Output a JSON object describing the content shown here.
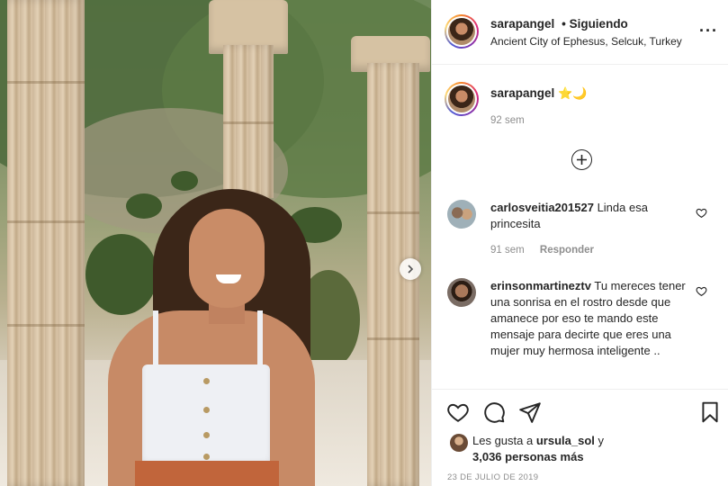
{
  "header": {
    "username": "sarapangel",
    "separator": "•",
    "follow_status": "Siguiendo",
    "location": "Ancient City of Ephesus, Selcuk, Turkey",
    "more_icon": "more-options-icon"
  },
  "caption": {
    "username": "sarapangel",
    "emojis": "⭐🌙",
    "time": "92 sem"
  },
  "comments": [
    {
      "username": "carlosveitia201527",
      "text": "Linda esa princesita",
      "time": "91 sem",
      "reply_label": "Responder"
    },
    {
      "username": "erinsonmartineztv",
      "text": "Tu mereces tener una sonrisa en el rostro desde que amanece por eso te mando este mensaje para decirte que eres una mujer muy hermosa inteligente .."
    }
  ],
  "likes": {
    "prefix": "Les gusta a",
    "user": "ursula_sol",
    "conjunction": "y",
    "count_text": "3,036 personas más"
  },
  "date": "23 DE JULIO DE 2019",
  "colors": {
    "text": "#262626",
    "secondary": "#8e8e8e",
    "border": "#efefef"
  }
}
